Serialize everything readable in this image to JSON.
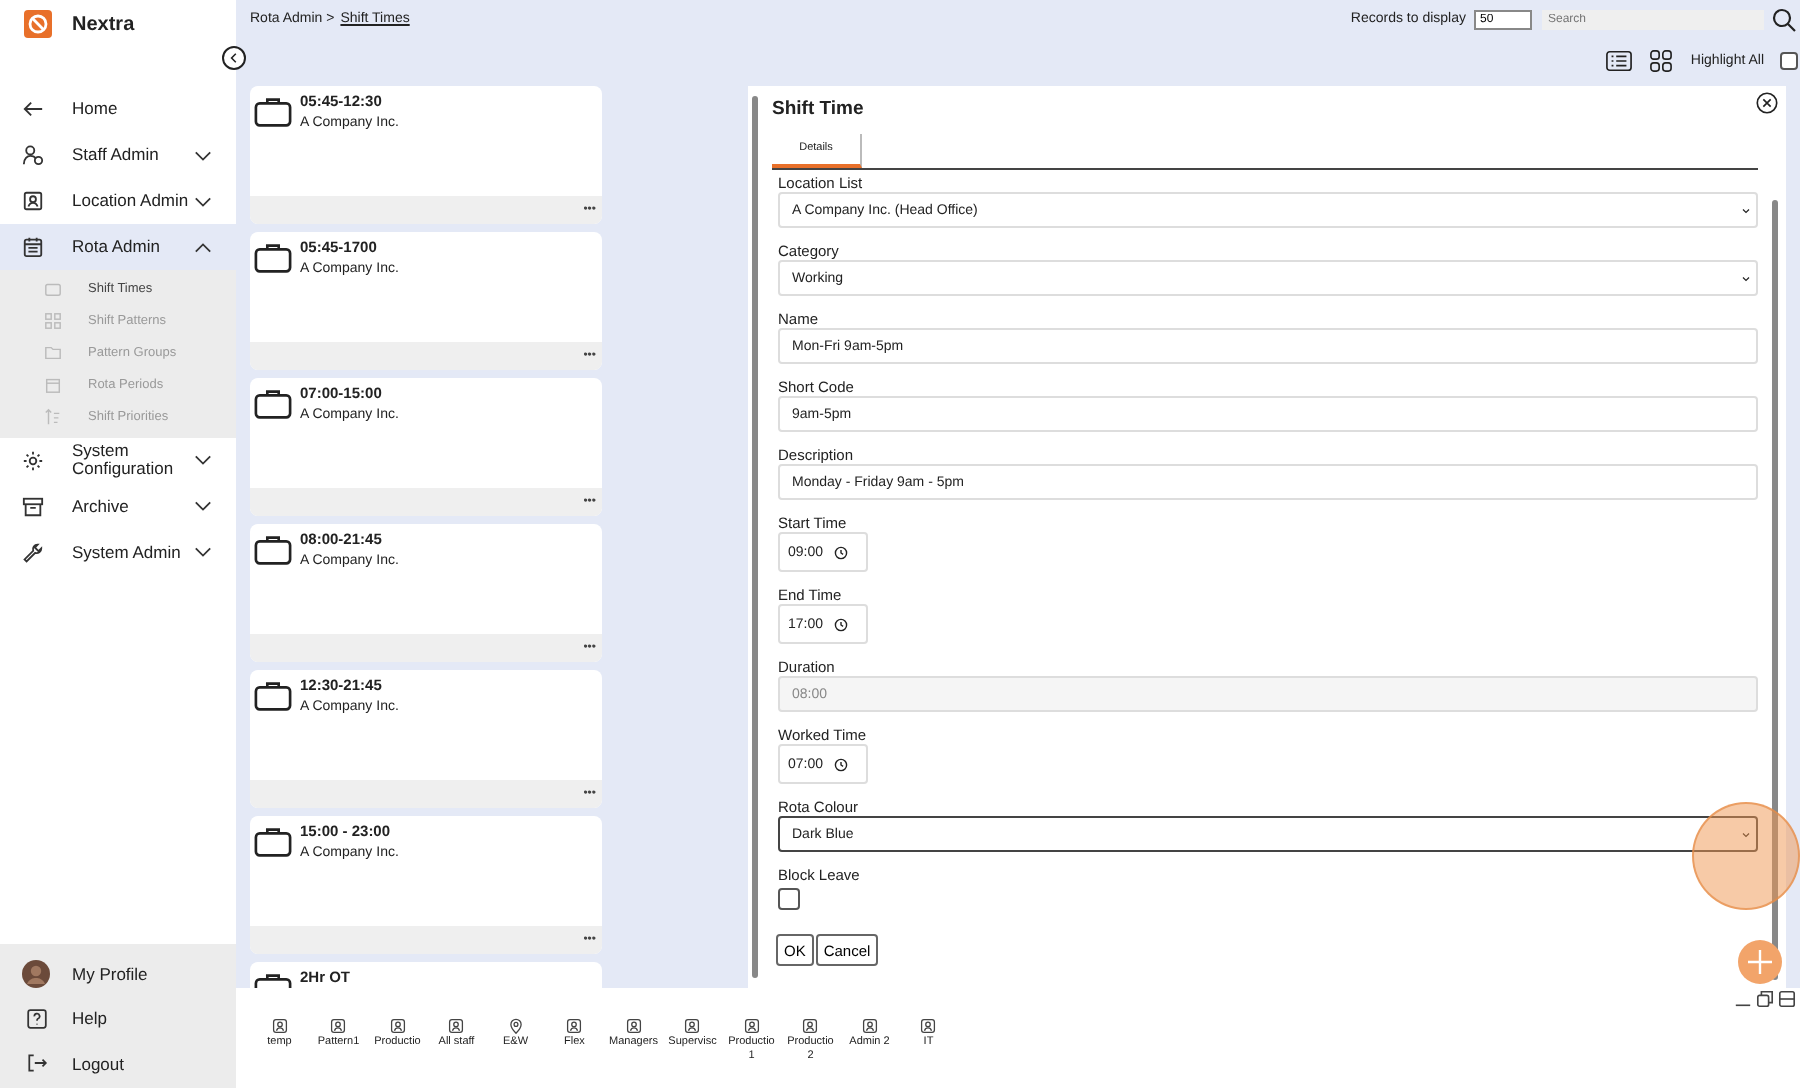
{
  "app": {
    "name": "Nextra"
  },
  "sidebar": {
    "items": [
      {
        "label": "Home",
        "selected": false
      },
      {
        "label": "Staff Admin",
        "selected": false,
        "expanded": false
      },
      {
        "label": "Location Admin",
        "selected": false,
        "expanded": false
      },
      {
        "label": "Rota Admin",
        "selected": true,
        "expanded": true,
        "children": [
          {
            "label": "Shift Times",
            "selected": true
          },
          {
            "label": "Shift Patterns",
            "selected": false
          },
          {
            "label": "Pattern Groups",
            "selected": false
          },
          {
            "label": "Rota Periods",
            "selected": false
          },
          {
            "label": "Shift Priorities",
            "selected": false
          }
        ]
      },
      {
        "label": "System Configuration",
        "selected": false,
        "expanded": false
      },
      {
        "label": "Archive",
        "selected": false,
        "expanded": false
      },
      {
        "label": "System Admin",
        "selected": false,
        "expanded": false
      }
    ],
    "footer": [
      {
        "label": "My Profile",
        "kind": "profile"
      },
      {
        "label": "Help",
        "kind": "help"
      },
      {
        "label": "Logout",
        "kind": "logout"
      }
    ]
  },
  "breadcrumb": {
    "parent": "Rota Admin >",
    "current": "Shift Times"
  },
  "toolbar": {
    "records_label": "Records to display",
    "records_value": "50",
    "search_placeholder": "Search",
    "highlight_label": "Highlight All",
    "highlight_checked": false
  },
  "cards": [
    {
      "title": "05:45-12:30",
      "company": "A Company Inc.",
      "menu": "•••"
    },
    {
      "title": "05:45-1700",
      "company": "A Company Inc.",
      "menu": "•••"
    },
    {
      "title": "07:00-15:00",
      "company": "A Company Inc.",
      "menu": "•••"
    },
    {
      "title": "08:00-21:45",
      "company": "A Company Inc.",
      "menu": "•••"
    },
    {
      "title": "12:30-21:45",
      "company": "A Company Inc.",
      "menu": "•••"
    },
    {
      "title": "15:00 - 23:00",
      "company": "A Company Inc.",
      "menu": "•••"
    },
    {
      "title": "2Hr OT"
    }
  ],
  "panel": {
    "title": "Shift Time",
    "tabs": [
      {
        "label": "Details",
        "selected": true
      }
    ],
    "fields": [
      {
        "kind": "select",
        "label": "Location List",
        "value": "A Company Inc. (Head Office)",
        "focused": false
      },
      {
        "kind": "select",
        "label": "Category",
        "value": "Working",
        "focused": false
      },
      {
        "kind": "text",
        "label": "Name",
        "value": "Mon-Fri 9am-5pm",
        "disabled": false
      },
      {
        "kind": "text",
        "label": "Short Code",
        "value": "9am-5pm",
        "disabled": false
      },
      {
        "kind": "text",
        "label": "Description",
        "value": "Monday - Friday 9am - 5pm",
        "disabled": false
      },
      {
        "kind": "time",
        "label": "Start Time",
        "value": "09:00"
      },
      {
        "kind": "time",
        "label": "End Time",
        "value": "17:00"
      },
      {
        "kind": "text",
        "label": "Duration",
        "value": "08:00",
        "disabled": true
      },
      {
        "kind": "time",
        "label": "Worked Time",
        "value": "07:00"
      },
      {
        "kind": "select",
        "label": "Rota Colour",
        "value": "Dark Blue",
        "focused": true
      },
      {
        "kind": "checkbox",
        "label": "Block Leave",
        "checked": false
      }
    ],
    "buttons": [
      "OK",
      "Cancel"
    ]
  },
  "bottom_tabs": [
    {
      "label": "temp",
      "kind": "group"
    },
    {
      "label": "Pattern1",
      "kind": "group"
    },
    {
      "label": "Productio",
      "kind": "group"
    },
    {
      "label": "All staff",
      "kind": "group"
    },
    {
      "label": "E&W",
      "kind": "place"
    },
    {
      "label": "Flex",
      "kind": "group"
    },
    {
      "label": "Managers",
      "kind": "group"
    },
    {
      "label": "Supervisc",
      "kind": "group"
    },
    {
      "label": "Productio\n1",
      "kind": "group"
    },
    {
      "label": "Productio\n2",
      "kind": "group"
    },
    {
      "label": "Admin 2",
      "kind": "group"
    },
    {
      "label": "IT",
      "kind": "group"
    }
  ]
}
